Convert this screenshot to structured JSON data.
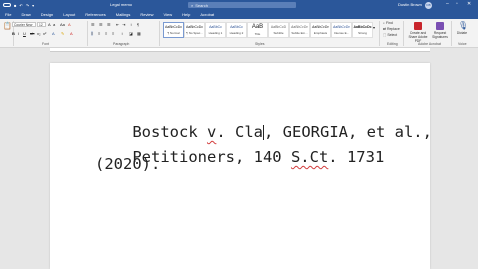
{
  "titlebar": {
    "autosave": "AutoSave",
    "doc_title": "Legal memo",
    "search_placeholder": "Search",
    "user_name": "Dustin Brown",
    "user_initials": "DB"
  },
  "menu": {
    "tabs": [
      "File",
      "Draw",
      "Design",
      "Layout",
      "References",
      "Mailings",
      "Review",
      "View",
      "Help",
      "Acrobat"
    ],
    "active_index": 0
  },
  "ribbon": {
    "font_name": "Courier New",
    "font_size": "12",
    "groups": {
      "font": "Font",
      "paragraph": "Paragraph",
      "styles": "Styles",
      "editing": "Editing",
      "adobe": "Adobe Acrobat",
      "voice": "Voice"
    },
    "styles": [
      {
        "sample": "AaBbCcDc",
        "name": "¶ Normal"
      },
      {
        "sample": "AaBbCcDc",
        "name": "¶ No Spac..."
      },
      {
        "sample": "AaBbCc",
        "name": "Heading 1"
      },
      {
        "sample": "AaBbCc",
        "name": "Heading 2"
      },
      {
        "sample": "AaB",
        "name": "Title"
      },
      {
        "sample": "AaBbCcD",
        "name": "Subtitle"
      },
      {
        "sample": "AaBbCcDc",
        "name": "Subtle Em..."
      },
      {
        "sample": "AaBbCcDc",
        "name": "Emphasis"
      },
      {
        "sample": "AaBbCcDc",
        "name": "Intense E..."
      },
      {
        "sample": "AaBbCcDc",
        "name": "Strong"
      }
    ],
    "editing": {
      "find": "Find",
      "replace": "Replace",
      "select": "Select"
    },
    "adobe": {
      "create_share": "Create and Share Adobe PDF",
      "request_sig": "Request Signatures"
    },
    "voice": {
      "dictate": "Dictate"
    }
  },
  "document": {
    "line1_a": "Bostock ",
    "line1_v": "v",
    "line1_b": ". Cla",
    "line1_c": ", GEORGIA, et al.,",
    "line2_a": "Petitioners, 140 ",
    "line2_sct": "S.Ct",
    "line2_b": ". 1731",
    "line3": "(2020)."
  },
  "colors": {
    "brand": "#2b579a",
    "spell_error": "#d23b3b"
  }
}
